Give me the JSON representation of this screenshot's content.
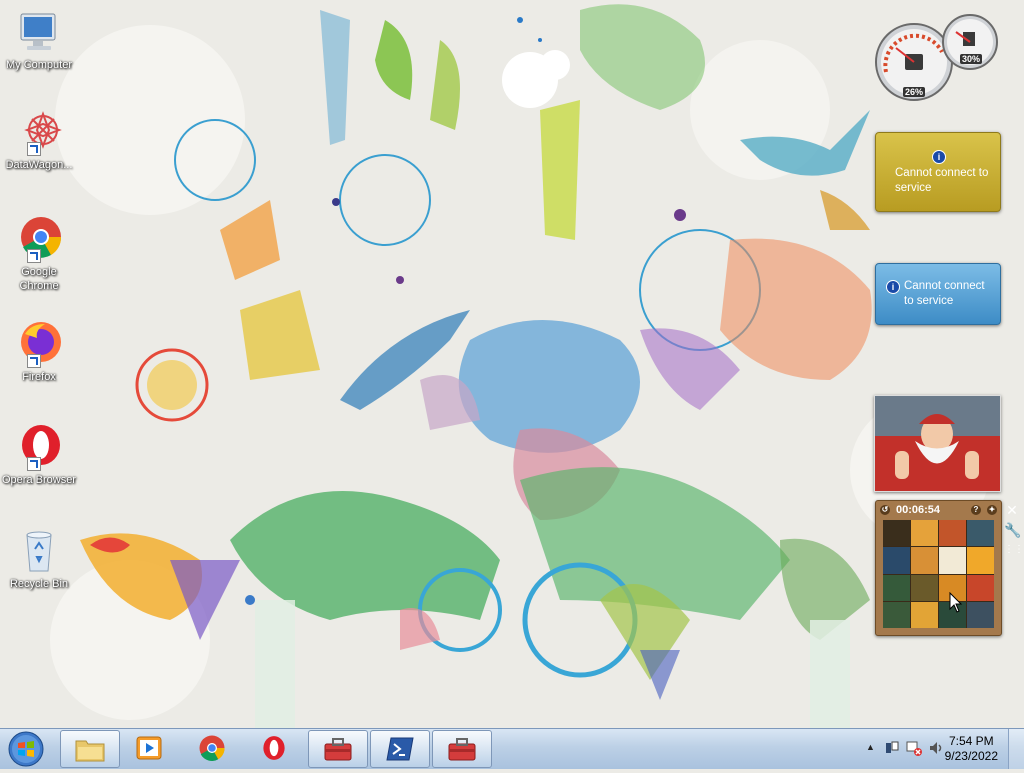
{
  "desktop": {
    "icons": [
      {
        "label": "My Computer",
        "icon": "computer-icon"
      },
      {
        "label": "DataWagon...",
        "icon": "datawagon-icon",
        "shortcut": true
      },
      {
        "label": "Google Chrome",
        "icon": "chrome-icon",
        "shortcut": true
      },
      {
        "label": "Firefox",
        "icon": "firefox-icon",
        "shortcut": true
      },
      {
        "label": "Opera Browser",
        "icon": "opera-icon",
        "shortcut": true
      },
      {
        "label": "Recycle Bin",
        "icon": "recycle-bin-icon"
      }
    ]
  },
  "gadgets": {
    "cpu_meter": {
      "cpu": "26%",
      "memory": "30%"
    },
    "news_1": {
      "message": "Cannot connect to service"
    },
    "news_2": {
      "message": "Cannot connect to service"
    },
    "puzzle": {
      "timer": "00:06:54"
    }
  },
  "taskbar": {
    "items": [
      {
        "name": "windows-explorer",
        "icon": "folder-icon",
        "active": true
      },
      {
        "name": "media-player",
        "icon": "media-player-icon"
      },
      {
        "name": "google-chrome",
        "icon": "chrome-icon"
      },
      {
        "name": "opera",
        "icon": "opera-icon"
      },
      {
        "name": "toolbox-app-1",
        "icon": "toolbox-icon"
      },
      {
        "name": "powershell",
        "icon": "powershell-icon"
      },
      {
        "name": "toolbox-app-2",
        "icon": "toolbox-icon"
      }
    ],
    "clock": {
      "time": "7:54 PM",
      "date": "9/23/2022"
    }
  },
  "colors": {
    "taskbar_top": "#d9e6f4",
    "taskbar_bottom": "#a9c2de",
    "news_gold": "#c9b034",
    "news_blue": "#5fa6d6",
    "puzzle_wood": "#a4794c"
  }
}
